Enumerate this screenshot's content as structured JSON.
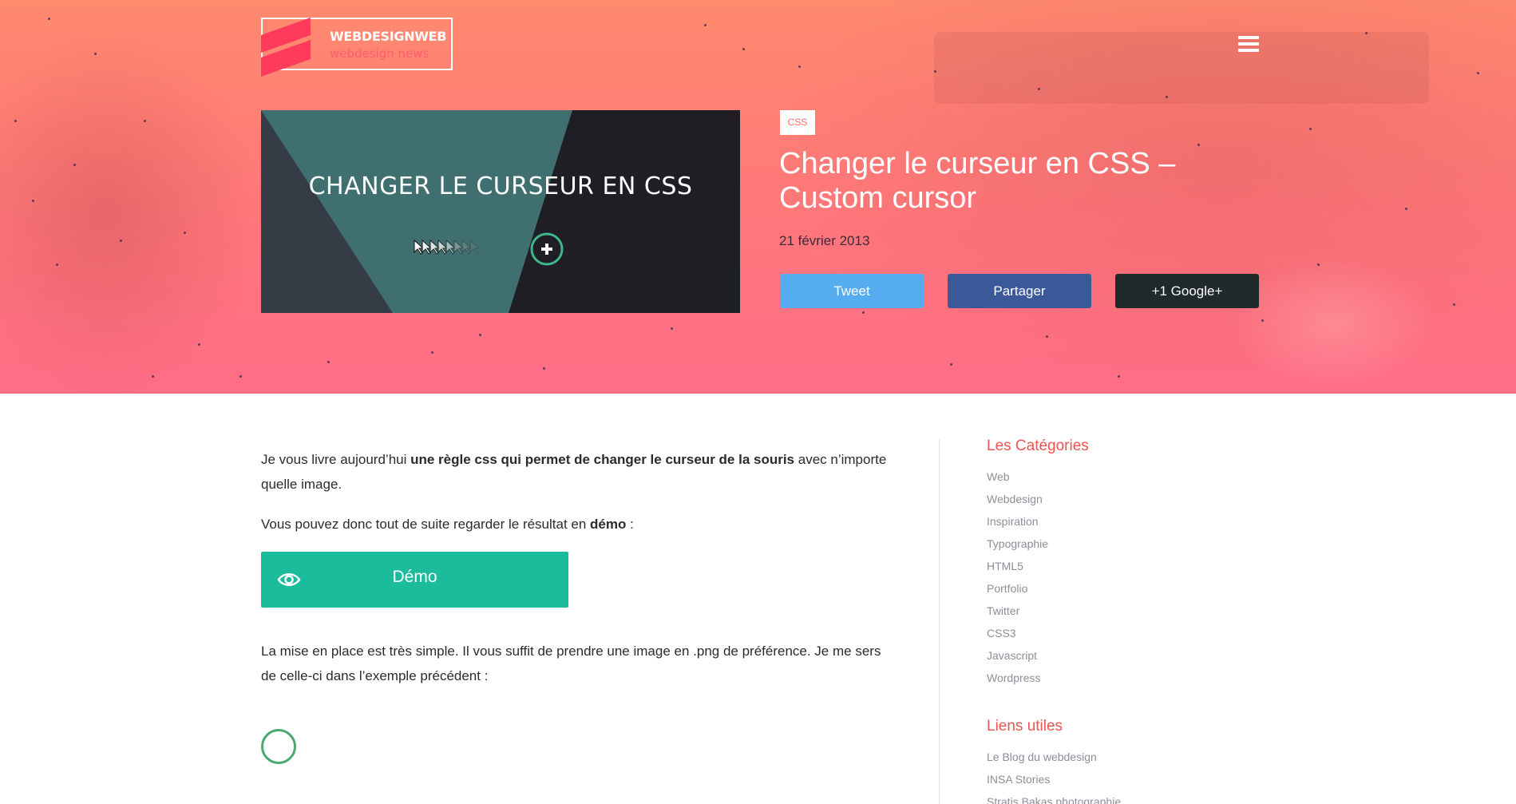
{
  "header": {
    "logo_name": "WEBDESIGNWEB",
    "logo_tagline": "webdesign news"
  },
  "hero": {
    "thumbnail_title": "CHANGER LE CURSEUR EN CSS",
    "category": "CSS",
    "title": "Changer le curseur en CSS – Custom cursor",
    "date": "21 février 2013",
    "share": {
      "tweet": "Tweet",
      "facebook": "Partager",
      "google": "+1 Google+"
    }
  },
  "article": {
    "p1_start": "Je vous livre aujourd’hui ",
    "p1_bold": "une règle css qui permet de changer le curseur de la souris",
    "p1_end": " avec n’importe quelle image.",
    "p2_start": "Vous pouvez donc tout de suite regarder le résultat en ",
    "p2_bold": "démo",
    "p2_end": " :",
    "demo_label": "Démo",
    "p3": "La mise en place est très simple. Il vous suffit de prendre une image en .png de préférence. Je me sers de celle-ci dans l’exemple précédent :"
  },
  "sidebar": {
    "categories_title": "Les Catégories",
    "categories": [
      "Web",
      "Webdesign",
      "Inspiration",
      "Typographie",
      "HTML5",
      "Portfolio",
      "Twitter",
      "CSS3",
      "Javascript",
      "Wordpress"
    ],
    "links_title": "Liens utiles",
    "links": [
      "Le Blog du webdesign",
      "INSA Stories",
      "Stratis Bakas photographie"
    ]
  },
  "colors": {
    "accent": "#ef5350",
    "demo": "#1abc9c",
    "tweet": "#55acee",
    "facebook": "#3b5998",
    "google": "#202a2b"
  }
}
